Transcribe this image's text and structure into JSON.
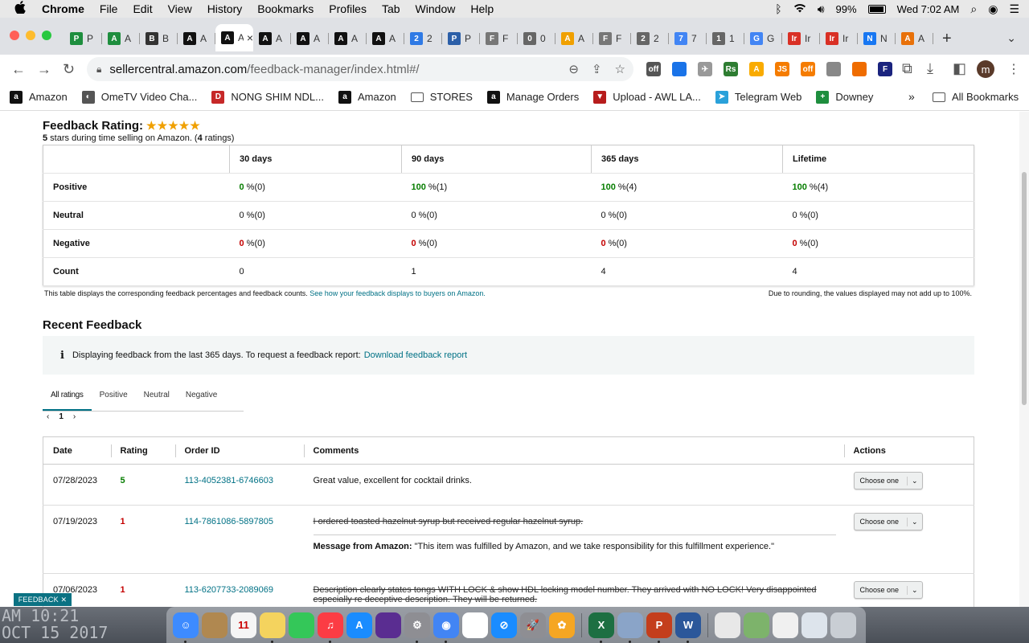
{
  "menubar": {
    "apple": "",
    "items": [
      "Chrome",
      "File",
      "Edit",
      "View",
      "History",
      "Bookmarks",
      "Profiles",
      "Tab",
      "Window",
      "Help"
    ],
    "battery": "99%",
    "clock": "Wed 7:02 AM"
  },
  "tabs": [
    {
      "letter": "P",
      "color": "#1e8e3e",
      "icon": "sheets-icon"
    },
    {
      "letter": "A",
      "color": "#1e8e3e",
      "icon": "sheets-icon"
    },
    {
      "letter": "B",
      "color": "#333",
      "icon": "amazon-icon"
    },
    {
      "letter": "A",
      "color": "#111",
      "icon": "amazon-icon"
    },
    {
      "letter": "A",
      "color": "#111",
      "icon": "amazon-icon",
      "active": true
    },
    {
      "letter": "A",
      "color": "#111",
      "icon": "amazon-icon"
    },
    {
      "letter": "A",
      "color": "#111",
      "icon": "amazon-icon"
    },
    {
      "letter": "A",
      "color": "#111",
      "icon": "amazon-icon"
    },
    {
      "letter": "A",
      "color": "#111",
      "icon": "amazon-icon"
    },
    {
      "letter": "2",
      "color": "#2f7ae5",
      "icon": "badge-icon"
    },
    {
      "letter": "P",
      "color": "#2c5fa8",
      "icon": "p-icon"
    },
    {
      "letter": "F",
      "color": "#777",
      "icon": "globe-icon"
    },
    {
      "letter": "0",
      "color": "#666",
      "icon": "globe-icon"
    },
    {
      "letter": "A",
      "color": "#f0a000",
      "icon": "amazon-smile-icon"
    },
    {
      "letter": "F",
      "color": "#777",
      "icon": "globe-icon"
    },
    {
      "letter": "2",
      "color": "#666",
      "icon": "globe-icon"
    },
    {
      "letter": "7",
      "color": "#4285f4",
      "icon": "google-icon"
    },
    {
      "letter": "1",
      "color": "#666",
      "icon": "globe-icon"
    },
    {
      "letter": "G",
      "color": "#4285f4",
      "icon": "google-icon"
    },
    {
      "letter": "Ir",
      "color": "#d93025",
      "icon": "gmail-icon"
    },
    {
      "letter": "Ir",
      "color": "#d93025",
      "icon": "gmail-icon"
    },
    {
      "letter": "N",
      "color": "#1877f2",
      "icon": "facebook-icon"
    },
    {
      "letter": "A",
      "color": "#e8710a",
      "icon": "pen-icon"
    }
  ],
  "address": {
    "domain": "sellercentral.amazon.com",
    "path": "/feedback-manager/index.html#/"
  },
  "extensions": [
    {
      "label": "off",
      "color": "#555"
    },
    {
      "label": "",
      "color": "#1a73e8"
    },
    {
      "label": "✈",
      "color": "#999"
    },
    {
      "label": "Rs",
      "color": "#2e7d32"
    },
    {
      "label": "A",
      "color": "#f9ab00"
    },
    {
      "label": "JS",
      "color": "#f57c00"
    },
    {
      "label": "off",
      "color": "#f57c00"
    },
    {
      "label": "",
      "color": "#888"
    },
    {
      "label": "",
      "color": "#ef6c00"
    },
    {
      "label": "F",
      "color": "#1a237e"
    }
  ],
  "profile_initial": "m",
  "bookmarks": [
    {
      "label": "Amazon",
      "color": "#111",
      "letter": "a",
      "icon": "amazon-icon"
    },
    {
      "label": "OmeTV Video Cha...",
      "color": "#555",
      "letter": "◐",
      "icon": "globe-icon"
    },
    {
      "label": "NONG SHIM NDL...",
      "color": "#c62828",
      "letter": "D",
      "icon": "pinterest-icon"
    },
    {
      "label": "Amazon",
      "color": "#111",
      "letter": "a",
      "icon": "amazon-icon"
    },
    {
      "label": "STORES",
      "color": "#fff",
      "letter": "",
      "icon": "folder-icon"
    },
    {
      "label": "Manage Orders",
      "color": "#111",
      "letter": "a",
      "icon": "amazon-icon"
    },
    {
      "label": "Upload - AWL LA...",
      "color": "#b71c1c",
      "letter": "▼",
      "icon": "awl-icon"
    },
    {
      "label": "Telegram Web",
      "color": "#2aa1da",
      "letter": "➤",
      "icon": "telegram-icon"
    },
    {
      "label": "Downey",
      "color": "#1e8e3e",
      "letter": "+",
      "icon": "sheets-icon"
    }
  ],
  "all_bookmarks": "All Bookmarks",
  "feedback": {
    "heading": "Feedback Rating:",
    "stars": "★★★★★",
    "sub_stars": "5",
    "sub_mid": " stars during time selling on Amazon. (",
    "sub_count": "4",
    "sub_end": " ratings)",
    "columns": [
      "30 days",
      "90 days",
      "365 days",
      "Lifetime"
    ],
    "rows": [
      {
        "label": "Positive",
        "cells": [
          {
            "v": "0",
            "c": "gn",
            "r": " %(0)"
          },
          {
            "v": "100",
            "c": "gn",
            "r": " %(1)"
          },
          {
            "v": "100",
            "c": "gn",
            "r": " %(4)"
          },
          {
            "v": "100",
            "c": "gn",
            "r": " %(4)"
          }
        ]
      },
      {
        "label": "Neutral",
        "cells": [
          {
            "v": "0",
            "c": "",
            "r": " %(0)"
          },
          {
            "v": "0",
            "c": "",
            "r": " %(0)"
          },
          {
            "v": "0",
            "c": "",
            "r": " %(0)"
          },
          {
            "v": "0",
            "c": "",
            "r": " %(0)"
          }
        ]
      },
      {
        "label": "Negative",
        "cells": [
          {
            "v": "0",
            "c": "rd",
            "r": " %(0)"
          },
          {
            "v": "0",
            "c": "rd",
            "r": " %(0)"
          },
          {
            "v": "0",
            "c": "rd",
            "r": " %(0)"
          },
          {
            "v": "0",
            "c": "rd",
            "r": " %(0)"
          }
        ]
      },
      {
        "label": "Count",
        "cells": [
          {
            "v": "",
            "c": "",
            "r": "0"
          },
          {
            "v": "",
            "c": "",
            "r": "1"
          },
          {
            "v": "",
            "c": "",
            "r": "4"
          },
          {
            "v": "",
            "c": "",
            "r": "4"
          }
        ]
      }
    ],
    "caption": "This table displays the corresponding feedback percentages and feedback counts.",
    "caption_link": "See how your feedback displays to buyers on Amazon.",
    "caption_right": "Due to rounding, the values displayed may not add up to 100%."
  },
  "recent": {
    "heading": "Recent Feedback",
    "info_icon": "i",
    "info": "Displaying feedback from the last 365 days. To request a feedback report:",
    "info_link": "Download feedback report",
    "tabs": [
      "All ratings",
      "Positive",
      "Neutral",
      "Negative"
    ],
    "page": "1",
    "prev": "‹",
    "next": "›",
    "headers": [
      "Date",
      "Rating",
      "Order ID",
      "Comments",
      "Actions"
    ],
    "action_label": "Choose one",
    "rows": [
      {
        "date": "07/28/2023",
        "rating": "5",
        "rating_class": "gn",
        "order": "113-4052381-6746603",
        "comment": "Great value, excellent for cocktail drinks.",
        "strike": false,
        "msg_label": "",
        "msg": ""
      },
      {
        "date": "07/19/2023",
        "rating": "1",
        "rating_class": "rd",
        "order": "114-7861086-5897805",
        "comment": "I ordered toasted hazelnut syrup but received regular hazelnut syrup.",
        "strike": true,
        "msg_label": "Message from Amazon:",
        "msg": " \"This item was fulfilled by Amazon, and we take responsibility for this fulfillment experience.\""
      },
      {
        "date": "07/06/2023",
        "rating": "1",
        "rating_class": "rd",
        "order": "113-6207733-2089069",
        "comment": "Description clearly states tongs WITH LOCK & show HDL locking model number. They arrived with NO LOCK! Very disappointed especially re deceptive description. They will be returned.",
        "strike": true,
        "msg_label": "",
        "msg": ""
      }
    ]
  },
  "feedback_tag": "FEEDBACK ✕",
  "desktop_text": [
    "AM 10:21",
    "OCT 15 2017"
  ],
  "dock": [
    {
      "name": "finder-icon",
      "color": "#3d8bff",
      "label": "☺",
      "dot": true
    },
    {
      "name": "archive-icon",
      "color": "#b08850",
      "label": "",
      "dot": false
    },
    {
      "name": "calendar-icon",
      "color": "#f5f5f5",
      "label": "11",
      "dot": false
    },
    {
      "name": "notes-icon",
      "color": "#f4d35e",
      "label": "",
      "dot": true
    },
    {
      "name": "facetime-icon",
      "color": "#34c759",
      "label": "",
      "dot": false
    },
    {
      "name": "music-icon",
      "color": "#fc3c44",
      "label": "♫",
      "dot": true
    },
    {
      "name": "appstore-icon",
      "color": "#1a8cff",
      "label": "A",
      "dot": false
    },
    {
      "name": "siri-icon",
      "color": "#5a2d91",
      "label": "",
      "dot": false
    },
    {
      "name": "settings-icon",
      "color": "#8e8e93",
      "label": "⚙",
      "dot": true
    },
    {
      "name": "chrome-icon",
      "color": "#4285f4",
      "label": "◉",
      "dot": true
    },
    {
      "name": "reminders-icon",
      "color": "#ffffff",
      "label": "",
      "dot": false
    },
    {
      "name": "safari-icon",
      "color": "#1a8cff",
      "label": "⊘",
      "dot": false
    },
    {
      "name": "launchpad-icon",
      "color": "#8e8e93",
      "label": "🚀",
      "dot": false
    },
    {
      "name": "photos-icon",
      "color": "#f5a623",
      "label": "✿",
      "dot": false
    },
    {
      "name": "excel-icon",
      "color": "#1d6f42",
      "label": "X",
      "dot": true
    },
    {
      "name": "preview-icon",
      "color": "#8aa4c8",
      "label": "",
      "dot": true
    },
    {
      "name": "powerpoint-icon",
      "color": "#c43e1c",
      "label": "P",
      "dot": true
    },
    {
      "name": "word-icon",
      "color": "#2b579a",
      "label": "W",
      "dot": true
    },
    {
      "name": "document-icon",
      "color": "#e8e8e8",
      "label": "",
      "dot": false
    },
    {
      "name": "image-icon",
      "color": "#7db36b",
      "label": "",
      "dot": false
    },
    {
      "name": "file-icon",
      "color": "#f0f0f0",
      "label": "",
      "dot": false
    },
    {
      "name": "screenshot-icon",
      "color": "#dde4ec",
      "label": "",
      "dot": false
    },
    {
      "name": "trash-icon",
      "color": "#c9ced4",
      "label": "",
      "dot": false
    }
  ]
}
